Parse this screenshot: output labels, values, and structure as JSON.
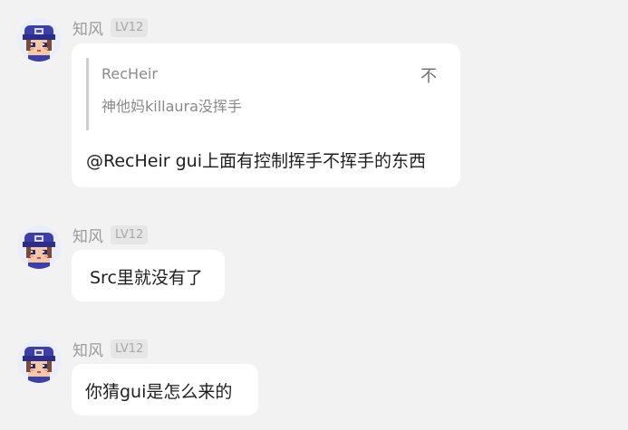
{
  "messages": [
    {
      "sender": "知风",
      "level": "LV12",
      "quote": {
        "author": "RecHeir",
        "text": "神他妈killaura没挥手",
        "icon": "不"
      },
      "text": "@RecHeir gui上面有控制挥手不挥手的东西"
    },
    {
      "sender": "知风",
      "level": "LV12",
      "text": "Src里就没有了"
    },
    {
      "sender": "知风",
      "level": "LV12",
      "text": "你猜gui是怎么来的"
    }
  ],
  "colors": {
    "background": "#f2f2f2",
    "bubble": "#ffffff",
    "name": "#9a9a9a",
    "avatar_hat": "#3d3fa8"
  }
}
